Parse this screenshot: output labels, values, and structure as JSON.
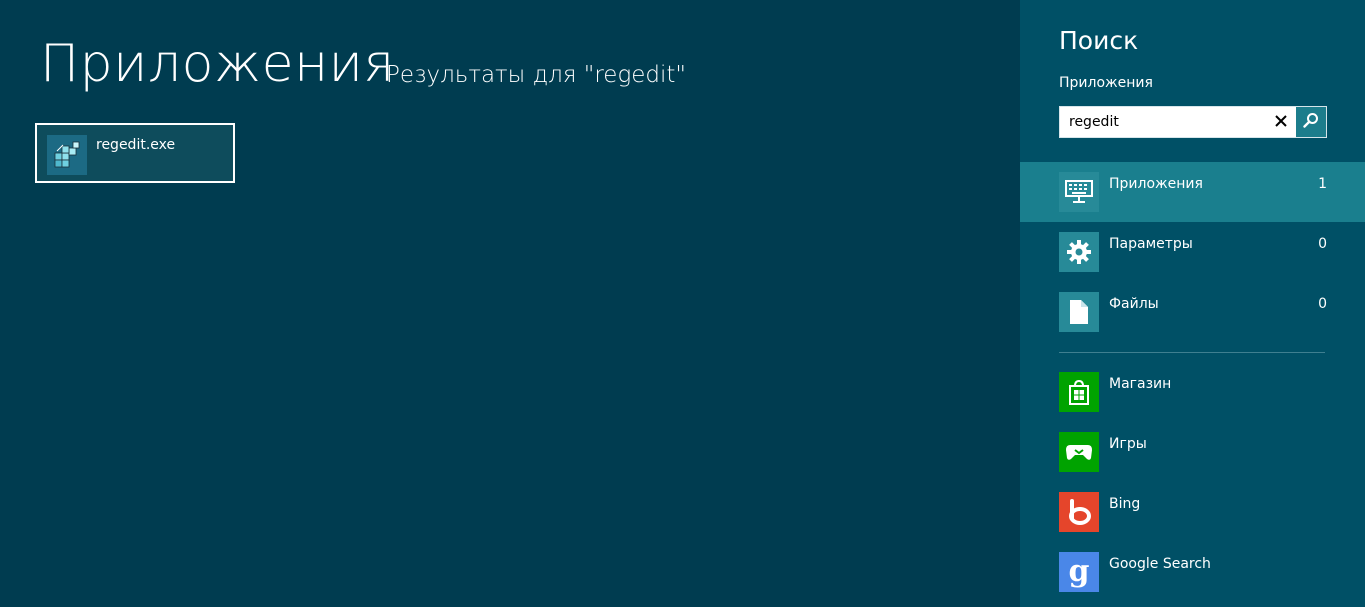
{
  "main": {
    "title": "Приложения",
    "results_for": "Результаты для \"regedit\"",
    "results": [
      {
        "name": "regedit.exe",
        "icon": "regedit-icon"
      }
    ]
  },
  "charm": {
    "title": "Поиск",
    "scope_label": "Приложения",
    "search": {
      "value": "regedit",
      "placeholder": ""
    },
    "scopes": [
      {
        "label": "Приложения",
        "count": "1",
        "icon": "keyboard-monitor-icon",
        "selected": true
      },
      {
        "label": "Параметры",
        "count": "0",
        "icon": "gear-icon"
      },
      {
        "label": "Файлы",
        "count": "0",
        "icon": "file-icon"
      }
    ],
    "apps": [
      {
        "label": "Магазин",
        "icon": "store-icon",
        "color": "#00a300"
      },
      {
        "label": "Игры",
        "icon": "gamepad-icon",
        "color": "#00a300"
      },
      {
        "label": "Bing",
        "icon": "bing-icon",
        "color": "#e5452b"
      },
      {
        "label": "Google Search",
        "icon": "google-icon",
        "color": "#4a87e8"
      }
    ]
  },
  "colors": {
    "background": "#003c50",
    "charm_background": "#005066",
    "selected_scope": "#1a7f8e",
    "scope_icon": "#278a98"
  }
}
